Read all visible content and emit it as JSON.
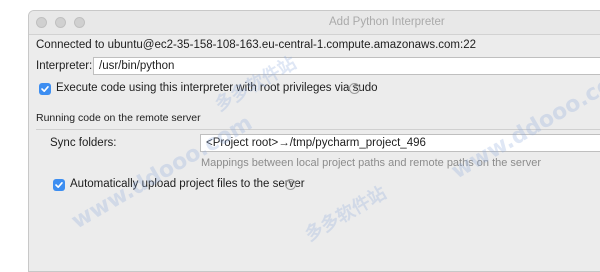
{
  "window": {
    "title": "Add Python Interpreter"
  },
  "connection": {
    "text": "Connected to ubuntu@ec2-35-158-108-163.eu-central-1.compute.amazonaws.com:22"
  },
  "interpreter": {
    "label": "Interpreter:",
    "value": "/usr/bin/python"
  },
  "sudo_option": {
    "label": "Execute code using this interpreter with root privileges via sudo",
    "checked": true,
    "help": "?"
  },
  "remote_section": {
    "title": "Running code on the remote server"
  },
  "sync": {
    "label": "Sync folders:",
    "value": "<Project root>→/tmp/pycharm_project_496",
    "hint": "Mappings between local project paths and remote paths on the server"
  },
  "auto_upload": {
    "label": "Automatically upload project files to the server",
    "checked": true,
    "help": "?"
  },
  "watermarks": [
    "www.ddooo.com",
    "多多软件站",
    "www.ddooo.com",
    "多多软件站"
  ]
}
